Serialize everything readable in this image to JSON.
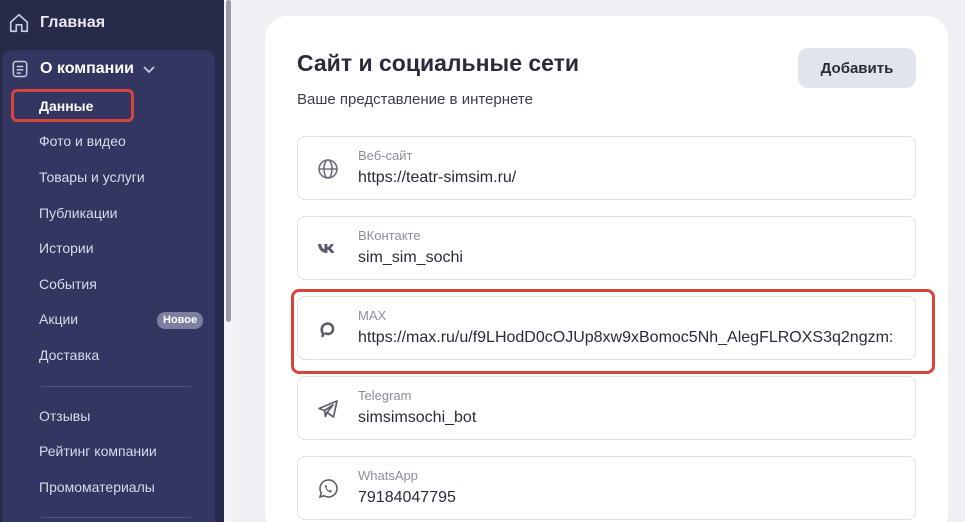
{
  "sidebar": {
    "home_label": "Главная",
    "company_label": "О компании",
    "items": [
      {
        "label": "Данные"
      },
      {
        "label": "Фото и видео"
      },
      {
        "label": "Товары и услуги"
      },
      {
        "label": "Публикации"
      },
      {
        "label": "Истории"
      },
      {
        "label": "События"
      },
      {
        "label": "Акции"
      },
      {
        "label": "Доставка"
      },
      {
        "label": "Отзывы"
      },
      {
        "label": "Рейтинг компании"
      },
      {
        "label": "Промоматериалы"
      }
    ],
    "badge_new": "Новое",
    "active_item": "Данные"
  },
  "main": {
    "title": "Сайт и социальные сети",
    "subtitle": "Ваше представление в интернете",
    "add_button_label": "Добавить",
    "fields": [
      {
        "label": "Веб-сайт",
        "value": "https://teatr-simsim.ru/",
        "icon": "globe-icon"
      },
      {
        "label": "ВКонтакте",
        "value": "sim_sim_sochi",
        "icon": "vk-icon"
      },
      {
        "label": "MAX",
        "value": "https://max.ru/u/f9LHodD0cOJUp8xw9xBomoc5Nh_AlegFLROXS3q2ngzm:",
        "icon": "max-icon"
      },
      {
        "label": "Telegram",
        "value": "simsimsochi_bot",
        "icon": "telegram-icon"
      },
      {
        "label": "WhatsApp",
        "value": "79184047795",
        "icon": "whatsapp-icon"
      }
    ]
  },
  "colors": {
    "sidebar_bg": "#272a48",
    "highlight": "#d8443c"
  }
}
